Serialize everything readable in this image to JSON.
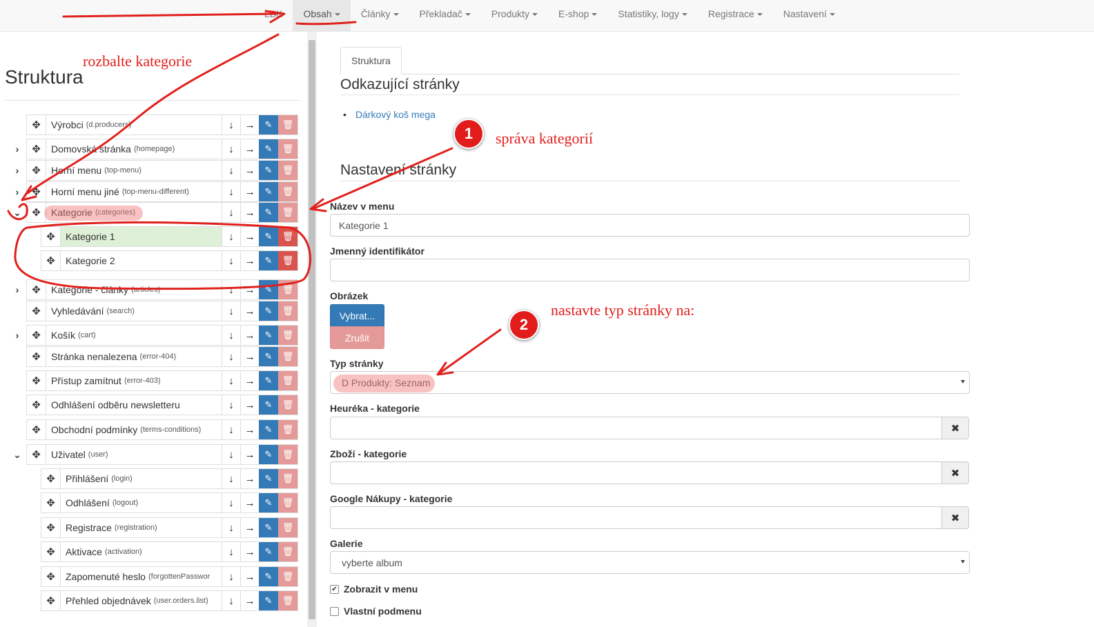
{
  "nav": {
    "items": [
      {
        "label": "LBK",
        "caret": false,
        "active": false
      },
      {
        "label": "Obsah",
        "caret": true,
        "active": true
      },
      {
        "label": "Články",
        "caret": true,
        "active": false
      },
      {
        "label": "Překladač",
        "caret": true,
        "active": false
      },
      {
        "label": "Produkty",
        "caret": true,
        "active": false
      },
      {
        "label": "E-shop",
        "caret": true,
        "active": false
      },
      {
        "label": "Statistiky, logy",
        "caret": true,
        "active": false
      },
      {
        "label": "Registrace",
        "caret": true,
        "active": false
      },
      {
        "label": "Nastavení",
        "caret": true,
        "active": false
      }
    ]
  },
  "left": {
    "title": "Struktura",
    "rows": [
      {
        "label": "Výrobci",
        "code": "(d.producers)",
        "toggle": "",
        "indent": 0
      },
      {
        "label": "Domovská stránka",
        "code": "(homepage)",
        "toggle": "›",
        "indent": 0
      },
      {
        "label": "Horní menu",
        "code": "(top-menu)",
        "toggle": "›",
        "indent": 0
      },
      {
        "label": "Horní menu jiné",
        "code": "(top-menu-different)",
        "toggle": "›",
        "indent": 0
      },
      {
        "label": "Kategorie",
        "code": "(categories)",
        "toggle": "⌄",
        "indent": 0
      },
      {
        "label": "Kategorie 1",
        "code": "",
        "toggle": "",
        "indent": 1,
        "selected": true
      },
      {
        "label": "Kategorie 2",
        "code": "",
        "toggle": "",
        "indent": 1
      },
      {
        "label": "Kategorie - články",
        "code": "(articles)",
        "toggle": "›",
        "indent": 0
      },
      {
        "label": "Vyhledávání",
        "code": "(search)",
        "toggle": "",
        "indent": 0
      },
      {
        "label": "Košík",
        "code": "(cart)",
        "toggle": "›",
        "indent": 0
      },
      {
        "label": "Stránka nenalezena",
        "code": "(error-404)",
        "toggle": "",
        "indent": 0
      },
      {
        "label": "Přístup zamítnut",
        "code": "(error-403)",
        "toggle": "",
        "indent": 0
      },
      {
        "label": "Odhlášení odběru newsletteru",
        "code": "",
        "toggle": "",
        "indent": 0
      },
      {
        "label": "Obchodní podmínky",
        "code": "(terms-conditions)",
        "toggle": "",
        "indent": 0
      },
      {
        "label": "Uživatel",
        "code": "(user)",
        "toggle": "⌄",
        "indent": 0
      },
      {
        "label": "Přihlášení",
        "code": "(login)",
        "toggle": "",
        "indent": 1
      },
      {
        "label": "Odhlášení",
        "code": "(logout)",
        "toggle": "",
        "indent": 1
      },
      {
        "label": "Registrace",
        "code": "(registration)",
        "toggle": "",
        "indent": 1
      },
      {
        "label": "Aktivace",
        "code": "(activation)",
        "toggle": "",
        "indent": 1
      },
      {
        "label": "Zapomenuté heslo",
        "code": "(forgottenPasswor",
        "toggle": "",
        "indent": 1
      },
      {
        "label": "Přehled objednávek",
        "code": "(user.orders.list)",
        "toggle": "",
        "indent": 1
      }
    ]
  },
  "right": {
    "tab_label": "Struktura",
    "referring_title": "Odkazující stránky",
    "referring_link": "Dárkový koš mega",
    "settings_title": "Nastavení stránky",
    "menu_name_label": "Název v menu",
    "menu_name_value": "Kategorie 1",
    "identifier_label": "Jmenný identifikátor",
    "identifier_value": "",
    "image_label": "Obrázek",
    "choose_button": "Vybrat...",
    "cancel_button": "Zrušit",
    "page_type_label": "Typ stránky",
    "page_type_value": "D Produkty: Seznam",
    "heureka_label": "Heuréka - kategorie",
    "zbozi_label": "Zboží - kategorie",
    "google_label": "Google Nákupy - kategorie",
    "clear_symbol": "✖",
    "gallery_label": "Galerie",
    "gallery_value": "vyberte album",
    "show_in_menu_label": "Zobrazit v menu",
    "show_in_menu_checked": true,
    "own_submenu_label": "Vlastní podmenu",
    "own_submenu_checked": false
  },
  "annotations": {
    "expand_note": "rozbalte kategorie",
    "manage_note": "správa kategorií",
    "set_type_note": "nastavte typ stránky na:",
    "badge1": "1",
    "badge2": "2",
    "color": "#e0201c"
  }
}
